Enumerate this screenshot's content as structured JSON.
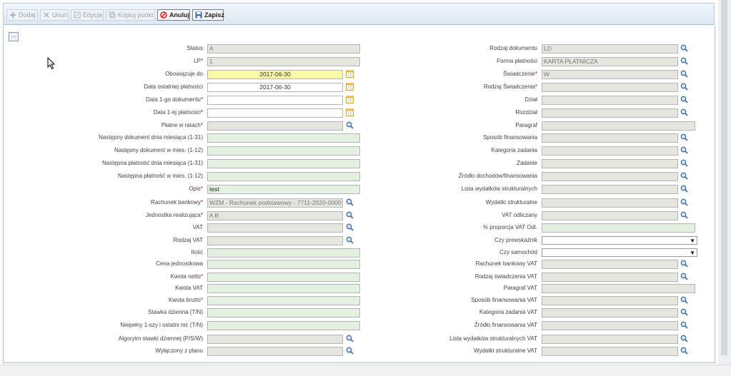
{
  "toolbar": {
    "add_label": "Dodaj",
    "delete_label": "Usuń",
    "edit_label": "Edycja",
    "copy_label": "Kopiuj punkt",
    "cancel_label": "Anuluj",
    "save_label": "Zapisz"
  },
  "expand_label": "...",
  "left": {
    "status": {
      "label": "Status",
      "value": "A"
    },
    "lp": {
      "label": "LP",
      "value": "1"
    },
    "obowiazuje_do": {
      "label": "Obowiązuje do",
      "value": "2017-06-30"
    },
    "data_ostatniej_platnosci": {
      "label": "Data ostatniej płatności",
      "value": "2017-06-30"
    },
    "data_1go_dokumentu": {
      "label": "Data 1-go dokumentu",
      "value": ""
    },
    "data_1ej_platnosci": {
      "label": "Data 1-ej płatności",
      "value": ""
    },
    "platne_w_ratach": {
      "label": "Płatne w ratach",
      "value": ""
    },
    "nastepny_dok_dnia": {
      "label": "Następny dokument dnia miesiąca (1-31)",
      "value": ""
    },
    "nastepny_dok_mies": {
      "label": "Następny dokument w mies. (1-12)",
      "value": ""
    },
    "nastepna_plat_dnia": {
      "label": "Następna płatność dnia miesiąca (1-31)",
      "value": ""
    },
    "nastepna_plat_mies": {
      "label": "Następna płatność w mies. (1-12)",
      "value": ""
    },
    "opis": {
      "label": "Opis",
      "value": "test"
    },
    "rachunek_bankowy": {
      "label": "Rachunek bankowy",
      "value": "WZM - Rachunek podstawowy - 7711-2020-0000"
    },
    "jednostka_realizujaca": {
      "label": "Jednostka realizująca",
      "value": "A B"
    },
    "vat": {
      "label": "VAT",
      "value": ""
    },
    "rodzaj_vat": {
      "label": "Rodzaj VAT",
      "value": ""
    },
    "ilosc": {
      "label": "Ilość",
      "value": ""
    },
    "cena_jednostkowa": {
      "label": "Cena jednostkowa",
      "value": ""
    },
    "kwota_netto": {
      "label": "Kwota netto",
      "value": ""
    },
    "kwota_vat": {
      "label": "Kwota VAT",
      "value": ""
    },
    "kwota_brutto": {
      "label": "Kwota brutto",
      "value": ""
    },
    "stawka_dzienna": {
      "label": "Stawka dzienna (T/N)",
      "value": ""
    },
    "niepelny": {
      "label": "Niepełny 1-szy i ostatni mc (T/N)",
      "value": ""
    },
    "algorytm": {
      "label": "Algorytm stawki dziennej (P/S/W)",
      "value": ""
    },
    "wylaczony": {
      "label": "Wyłączony z planu",
      "value": ""
    }
  },
  "right": {
    "rodzaj_dokumentu": {
      "label": "Rodzaj dokumentu",
      "value": "LD"
    },
    "forma_platnosci": {
      "label": "Forma płatności",
      "value": "KARTA PŁATNICZA"
    },
    "swiadczenie": {
      "label": "Świadczenie",
      "value": "W"
    },
    "rodzaj_swiadczenia": {
      "label": "Rodzaj Świadczenia",
      "value": ""
    },
    "dzial": {
      "label": "Dział",
      "value": ""
    },
    "rozdzial": {
      "label": "Rozdział",
      "value": ""
    },
    "paragraf": {
      "label": "Paragraf",
      "value": ""
    },
    "sposob_finansowania": {
      "label": "Sposób finansowania",
      "value": ""
    },
    "kategoria_zadania": {
      "label": "Kategoria zadania",
      "value": ""
    },
    "zadanie": {
      "label": "Zadanie",
      "value": ""
    },
    "zrodlo": {
      "label": "Źródło dochodów/finansowania",
      "value": ""
    },
    "lista_wydatkow": {
      "label": "Lista wydatków strukturalnych",
      "value": ""
    },
    "wydatki_strukturalne": {
      "label": "Wydatki strukturalne",
      "value": ""
    },
    "vat_odliczany": {
      "label": "VAT odliczany",
      "value": ""
    },
    "proporcja_vat": {
      "label": "% proporcja VAT Odl.",
      "value": ""
    },
    "czy_prewskaznik": {
      "label": "Czy prewskaźnik",
      "value": ""
    },
    "czy_samochod": {
      "label": "Czy samochód",
      "value": ""
    },
    "rachunek_vat": {
      "label": "Rachunek bankowy VAT",
      "value": ""
    },
    "rodzaj_swiadczenia_vat": {
      "label": "Rodzaj świadczenia VAT",
      "value": ""
    },
    "paragraf_vat": {
      "label": "Paragraf VAT",
      "value": ""
    },
    "sposob_vat": {
      "label": "Sposób finansowania VAT",
      "value": ""
    },
    "kategoria_vat": {
      "label": "Kategoria zadania VAT",
      "value": ""
    },
    "zrodlo_vat": {
      "label": "Źródło finansowania VAT",
      "value": ""
    },
    "lista_vat": {
      "label": "Lista wydatków strukturalnych VAT",
      "value": ""
    },
    "wydatki_vat": {
      "label": "Wydatki strukturalne VAT",
      "value": ""
    }
  },
  "required_marker": "*",
  "select_arrow": "▼",
  "colors": {
    "required": "#dd0000",
    "readonly_bg": "#e6e6e1",
    "editable_bg": "#e4f1e1",
    "focus_bg": "#fafaa8",
    "toolbar_bg": "#dde8f4"
  }
}
